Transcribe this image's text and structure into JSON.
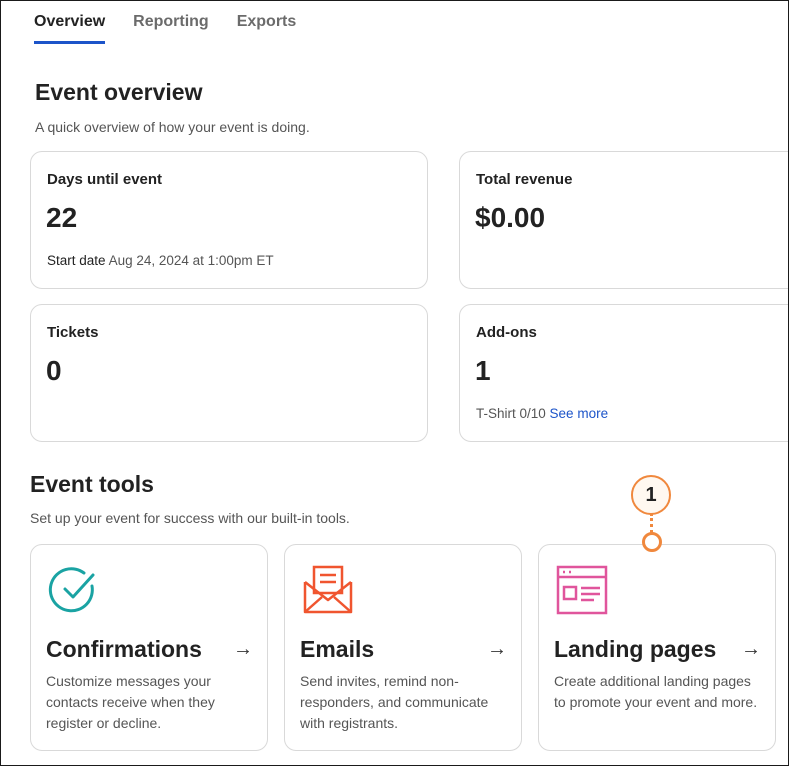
{
  "tabs": [
    {
      "label": "Overview",
      "active": true
    },
    {
      "label": "Reporting",
      "active": false
    },
    {
      "label": "Exports",
      "active": false
    }
  ],
  "overview": {
    "title": "Event overview",
    "subtitle": "A quick overview of how your event is doing."
  },
  "cards": {
    "days": {
      "title": "Days until event",
      "value": "22",
      "start_label": "Start date",
      "start_value": "Aug 24, 2024 at 1:00pm ET"
    },
    "revenue": {
      "title": "Total revenue",
      "value": "$0.00"
    },
    "tickets": {
      "title": "Tickets",
      "value": "0"
    },
    "addons": {
      "title": "Add-ons",
      "value": "1",
      "detail": "T-Shirt 0/10",
      "link": "See more"
    }
  },
  "tools_section": {
    "title": "Event tools",
    "subtitle": "Set up your event for success with our built-in tools."
  },
  "tools": [
    {
      "name": "Confirmations",
      "desc": "Customize messages your contacts receive when they register or decline.",
      "icon": "check-circle-icon",
      "color": "#1aa3a3"
    },
    {
      "name": "Emails",
      "desc": "Send invites, remind non-responders, and communicate with registrants.",
      "icon": "envelope-icon",
      "color": "#f0552f"
    },
    {
      "name": "Landing pages",
      "desc": "Create additional landing pages to promote your event and more.",
      "icon": "webpage-icon",
      "color": "#e0559c"
    }
  ],
  "callout": {
    "number": "1",
    "color": "#f0883d"
  },
  "colors": {
    "accent": "#1c54c9",
    "text": "#222222",
    "muted": "#555555",
    "border": "#d9d9d9"
  }
}
